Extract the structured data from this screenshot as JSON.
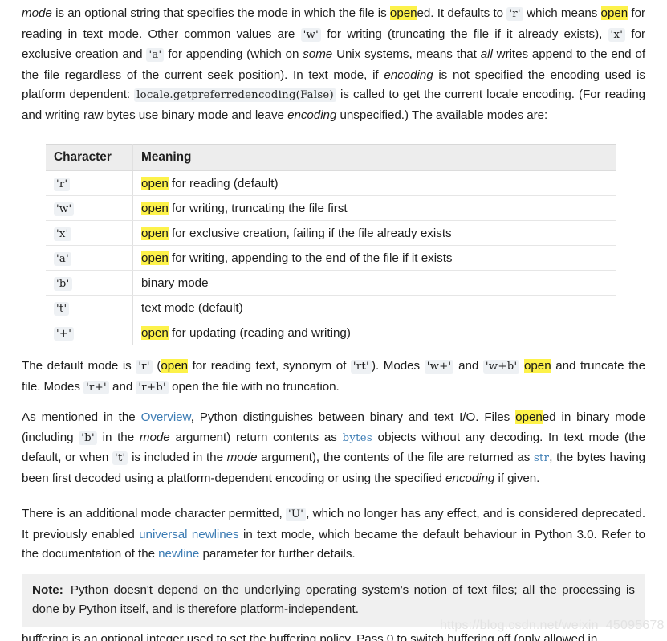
{
  "document": {
    "paragraph1": {
      "seg_mode": "mode",
      "t1": " is an optional string that specifies the mode in which the file is ",
      "hl_opened": "open",
      "t2": "ed. It defaults to ",
      "code_r": "'r'",
      "t3": " which means ",
      "hl_open": "open",
      "t4": " for reading in text mode. Other common values are ",
      "code_w": "'w'",
      "t5": " for writing (truncating the file if it already exists), ",
      "code_x": "'x'",
      "t6": " for exclusive creation and ",
      "code_a": "'a'",
      "t7": " for appending (which on ",
      "it_some": "some",
      "t8": " Unix systems, means that ",
      "it_all": "all",
      "t9": " writes append to the end of the file regardless of the current seek position). In text mode, if ",
      "it_encoding": "encoding",
      "t10": " is not specified the encoding used is platform dependent: ",
      "code_locale": "locale.getpreferredencoding(False)",
      "t11": " is called to get the current locale encoding. (For reading and writing raw bytes use binary mode and leave ",
      "it_encoding2": "encoding",
      "t12": " unspecified.) The available modes are:"
    },
    "table": {
      "headers": [
        "Character",
        "Meaning"
      ],
      "rows": [
        {
          "character": "'r'",
          "highlight": "open",
          "meaning": " for reading (default)"
        },
        {
          "character": "'w'",
          "highlight": "open",
          "meaning": " for writing, truncating the file first"
        },
        {
          "character": "'x'",
          "highlight": "open",
          "meaning": " for exclusive creation, failing if the file already exists"
        },
        {
          "character": "'a'",
          "highlight": "open",
          "meaning": " for writing, appending to the end of the file if it exists"
        },
        {
          "character": "'b'",
          "highlight": "",
          "meaning": "binary mode"
        },
        {
          "character": "'t'",
          "highlight": "",
          "meaning": "text mode (default)"
        },
        {
          "character": "'+'",
          "highlight": "open",
          "meaning": " for updating (reading and writing)"
        }
      ]
    },
    "paragraph2": {
      "t1": "The default mode is ",
      "code_r": "'r'",
      "t2": " (",
      "hl_open": "open",
      "t3": " for reading text, synonym of ",
      "code_rt": "'rt'",
      "t4": "). Modes ",
      "code_wplus": "'w+'",
      "t5": " and ",
      "code_wbplus": "'w+b'",
      "t6": " ",
      "hl_open2": "open",
      "t7": " and truncate the file. Modes ",
      "code_rplus": "'r+'",
      "t8": " and ",
      "code_rbplus": "'r+b'",
      "t9": " open the file with no truncation."
    },
    "paragraph3": {
      "t1": "As mentioned in the ",
      "link_overview": "Overview",
      "t2": ", Python distinguishes between binary and text I/O. Files ",
      "hl_opened": "open",
      "t3": "ed in binary mode (including ",
      "code_b": "'b'",
      "t4": " in the ",
      "it_mode": "mode",
      "t5": " argument) return contents as ",
      "code_bytes": "bytes",
      "t6": " objects without any decoding. In text mode (the default, or when ",
      "code_t": "'t'",
      "t7": " is included in the ",
      "it_mode2": "mode",
      "t8": " argument), the contents of the file are returned as ",
      "code_str": "str",
      "t9": ", the bytes having been first decoded using a platform-dependent encoding or using the specified ",
      "it_encoding": "encoding",
      "t10": " if given."
    },
    "paragraph4": {
      "t1": "There is an additional mode character permitted, ",
      "code_U": "'U'",
      "t2": ", which no longer has any effect, and is considered deprecated. It previously enabled ",
      "link_universal": "universal newlines",
      "t3": " in text mode, which became the default behaviour in Python 3.0. Refer to the documentation of the ",
      "link_newline": "newline",
      "t4": " parameter for further details."
    },
    "note": {
      "label": "Note:",
      "text": "Python doesn't depend on the underlying operating system's notion of text files; all the processing is done by Python itself, and is therefore platform-independent."
    },
    "paragraph5": {
      "text": "buffering is an optional integer used to set the buffering policy. Pass 0 to switch buffering off (only allowed in"
    },
    "watermark": {
      "text": "https://blog.csdn.net/weixin_45095678"
    }
  },
  "colors": {
    "highlight": "#fdf24a",
    "link": "#3c7cb4",
    "code_bg": "#eef1f4",
    "table_header_bg": "#ededed",
    "note_bg": "#f0f0f0",
    "watermark": "#e3e3e3"
  }
}
